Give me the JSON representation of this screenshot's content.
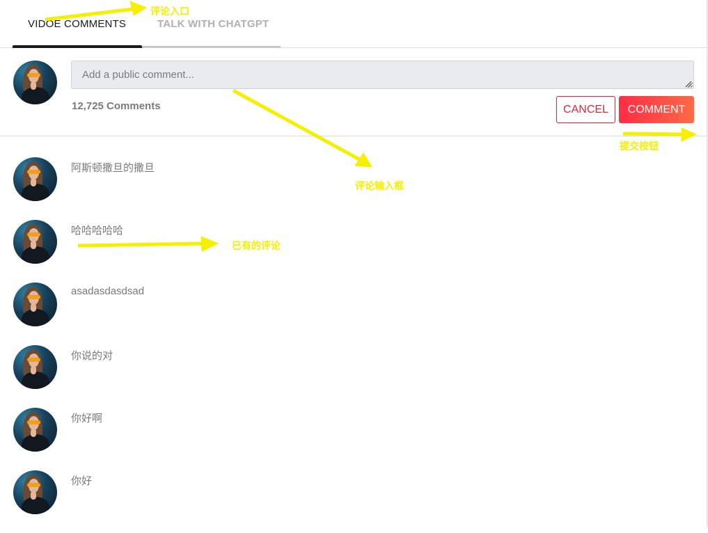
{
  "tabs": [
    {
      "label": "VIDOE COMMENTS",
      "active": true
    },
    {
      "label": "TALK WITH CHATGPT",
      "active": false
    }
  ],
  "comment_form": {
    "placeholder": "Add a public comment...",
    "value": "",
    "count_label": "12,725 Comments",
    "cancel_label": "CANCEL",
    "submit_label": "COMMENT"
  },
  "comments": [
    {
      "text": "阿斯顿撒旦的撒旦"
    },
    {
      "text": "哈哈哈哈哈"
    },
    {
      "text": "asadasdasdsad"
    },
    {
      "text": "你说的对"
    },
    {
      "text": "你好啊"
    },
    {
      "text": "你好"
    }
  ],
  "annotations": {
    "comment_entry": "评论入口",
    "comment_input_box": "评论输入框",
    "submit_button": "提交按钮",
    "existing_comments": "已有的评论"
  },
  "colors": {
    "accent_red": "#e0243a",
    "button_gradient_start": "#ff2d45",
    "button_gradient_end": "#ff6a45",
    "annotation_yellow": "#f5ef00"
  },
  "icons": {
    "avatar": "user-avatar-photo",
    "resize": "resize-grip-icon"
  }
}
